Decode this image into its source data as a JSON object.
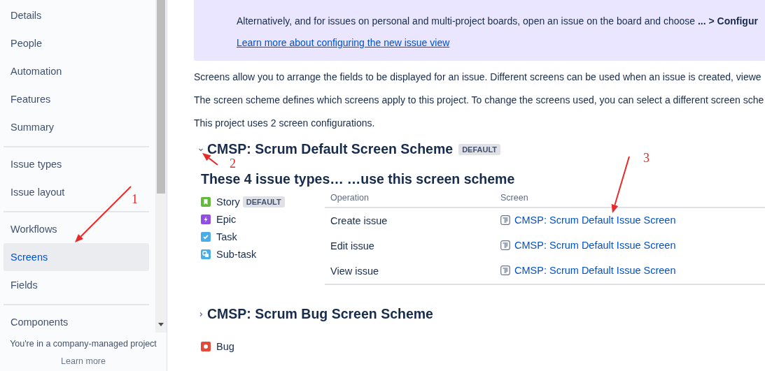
{
  "sidebar": {
    "groups": [
      {
        "items": [
          {
            "label": "Details",
            "selected": false
          },
          {
            "label": "People",
            "selected": false
          },
          {
            "label": "Automation",
            "selected": false
          },
          {
            "label": "Features",
            "selected": false
          },
          {
            "label": "Summary",
            "selected": false
          }
        ]
      },
      {
        "items": [
          {
            "label": "Issue types",
            "selected": false
          },
          {
            "label": "Issue layout",
            "selected": false
          }
        ]
      },
      {
        "items": [
          {
            "label": "Workflows",
            "selected": false
          },
          {
            "label": "Screens",
            "selected": true
          },
          {
            "label": "Fields",
            "selected": false
          }
        ]
      },
      {
        "items": [
          {
            "label": "Components",
            "selected": false
          }
        ]
      }
    ],
    "footer": {
      "text": "You're in a company-managed project",
      "link": "Learn more"
    }
  },
  "banner": {
    "paragraphs": [
      "Alternatively, and for issues on personal and multi-project boards, open an issue on the board and choose **... > Configur**"
    ],
    "link": "Learn more about configuring the new issue view"
  },
  "intro": [
    "Screens allow you to arrange the fields to be displayed for an issue. Different screens can be used when an issue is created, viewe",
    "The screen scheme defines which screens apply to this project. To change the screens used, you can select a different screen sche",
    "This project uses 2 screen configurations."
  ],
  "schemes": [
    {
      "name": "CMSP: Scrum Default Screen Scheme",
      "badge": "DEFAULT",
      "expanded": true,
      "heading_left": "These 4 issue types…",
      "heading_right": "…use this screen scheme",
      "issue_types": [
        {
          "name": "Story",
          "kind": "story",
          "badge": "DEFAULT"
        },
        {
          "name": "Epic",
          "kind": "epic"
        },
        {
          "name": "Task",
          "kind": "task"
        },
        {
          "name": "Sub-task",
          "kind": "subtask"
        }
      ],
      "table": {
        "columns": [
          "Operation",
          "Screen"
        ],
        "rows": [
          {
            "operation": "Create issue",
            "screen": "CMSP: Scrum Default Issue Screen"
          },
          {
            "operation": "Edit issue",
            "screen": "CMSP: Scrum Default Issue Screen"
          },
          {
            "operation": "View issue",
            "screen": "CMSP: Scrum Default Issue Screen"
          }
        ]
      }
    },
    {
      "name": "CMSP: Scrum Bug Screen Scheme",
      "expanded": false,
      "issue_types": [
        {
          "name": "Bug",
          "kind": "bug"
        }
      ]
    }
  ],
  "annotations": [
    {
      "label": "1"
    },
    {
      "label": "2"
    },
    {
      "label": "3"
    }
  ]
}
